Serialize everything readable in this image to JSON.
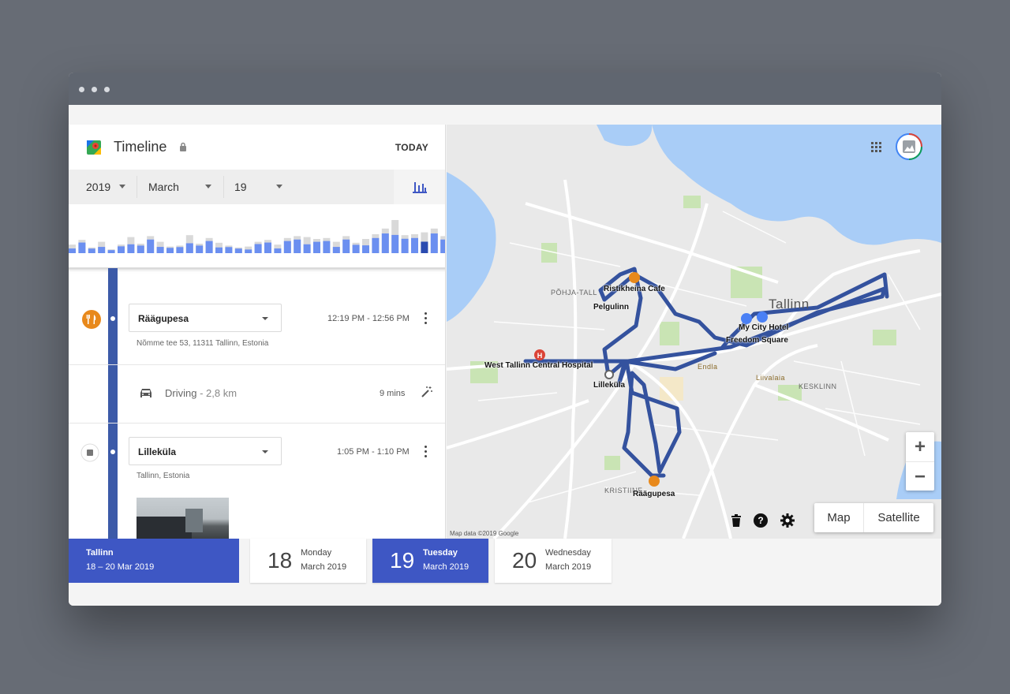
{
  "header": {
    "title": "Timeline",
    "today_label": "TODAY"
  },
  "date_selector": {
    "year": "2019",
    "month": "March",
    "day": "19"
  },
  "histogram": {
    "days": [
      {
        "v": 0.45,
        "hl": false
      },
      {
        "v": 0.7,
        "hl": false
      },
      {
        "v": 0.3,
        "hl": false
      },
      {
        "v": 0.6,
        "hl": false
      },
      {
        "v": 0.2,
        "hl": false
      },
      {
        "v": 0.45,
        "hl": false
      },
      {
        "v": 0.85,
        "hl": false
      },
      {
        "v": 0.5,
        "hl": false
      },
      {
        "v": 0.9,
        "hl": false
      },
      {
        "v": 0.6,
        "hl": false
      },
      {
        "v": 0.35,
        "hl": false
      },
      {
        "v": 0.4,
        "hl": false
      },
      {
        "v": 0.95,
        "hl": false
      },
      {
        "v": 0.5,
        "hl": false
      },
      {
        "v": 0.8,
        "hl": false
      },
      {
        "v": 0.55,
        "hl": false
      },
      {
        "v": 0.4,
        "hl": false
      },
      {
        "v": 0.3,
        "hl": false
      },
      {
        "v": 0.35,
        "hl": false
      },
      {
        "v": 0.6,
        "hl": false
      },
      {
        "v": 0.7,
        "hl": false
      },
      {
        "v": 0.45,
        "hl": false
      },
      {
        "v": 0.8,
        "hl": false
      },
      {
        "v": 0.9,
        "hl": false
      },
      {
        "v": 0.85,
        "hl": false
      },
      {
        "v": 0.75,
        "hl": false
      },
      {
        "v": 0.8,
        "hl": false
      },
      {
        "v": 0.6,
        "hl": false
      },
      {
        "v": 0.9,
        "hl": false
      },
      {
        "v": 0.55,
        "hl": false
      },
      {
        "v": 0.75,
        "hl": false
      },
      {
        "v": 1.0,
        "hl": false
      },
      {
        "v": 1.3,
        "hl": false
      },
      {
        "v": 1.75,
        "hl": false
      },
      {
        "v": 0.95,
        "hl": false
      },
      {
        "v": 1.0,
        "hl": false
      },
      {
        "v": 1.1,
        "hl": true
      },
      {
        "v": 1.3,
        "hl": false
      },
      {
        "v": 0.9,
        "hl": false
      },
      {
        "v": 0.55,
        "hl": false
      }
    ]
  },
  "timeline": {
    "entries": [
      {
        "place": "Räägupesa",
        "time": "12:19 PM - 12:56 PM",
        "address": "Nõmme tee 53, 11311 Tallinn, Estonia",
        "icon": "restaurant-icon"
      },
      {
        "place": "Lilleküla",
        "time": "1:05 PM - 1:10 PM",
        "address": "Tallinn, Estonia",
        "icon": "place-icon"
      }
    ],
    "drive": {
      "mode": "Driving",
      "distance": " - 2,8 km",
      "duration": "9 mins"
    }
  },
  "map": {
    "labels": {
      "ristikheina": "Ristikheina Cafe",
      "pelgulinn": "Pelgulinn",
      "pohja": "PÕHJA-TALL",
      "tallinn": "Tallinn",
      "hotel": "My City Hotel",
      "freedom": "Freedom Square",
      "hospital": "West Tallinn Central Hospital",
      "lillekula": "Lilleküla",
      "kesklinn": "KESKLINN",
      "kristiine": "KRISTIINE",
      "raagupesa": "Räägupesa",
      "endla": "Endla",
      "liivalaia": "Liivalaia"
    },
    "map_data_text": "Map data ©2019 Google",
    "type_map": "Map",
    "type_satellite": "Satellite",
    "zoom_in": "+",
    "zoom_out": "−"
  },
  "trip": {
    "city": "Tallinn",
    "range": "18 – 20 Mar 2019"
  },
  "days": [
    {
      "num": "18",
      "weekday": "Monday",
      "month": "March 2019",
      "active": false
    },
    {
      "num": "19",
      "weekday": "Tuesday",
      "month": "March 2019",
      "active": true
    },
    {
      "num": "20",
      "weekday": "Wednesday",
      "month": "March 2019",
      "active": false
    }
  ],
  "colors": {
    "accent": "#3e57c4",
    "route": "#34529e",
    "food_pin": "#e8891c",
    "water": "#a9cdf7"
  }
}
